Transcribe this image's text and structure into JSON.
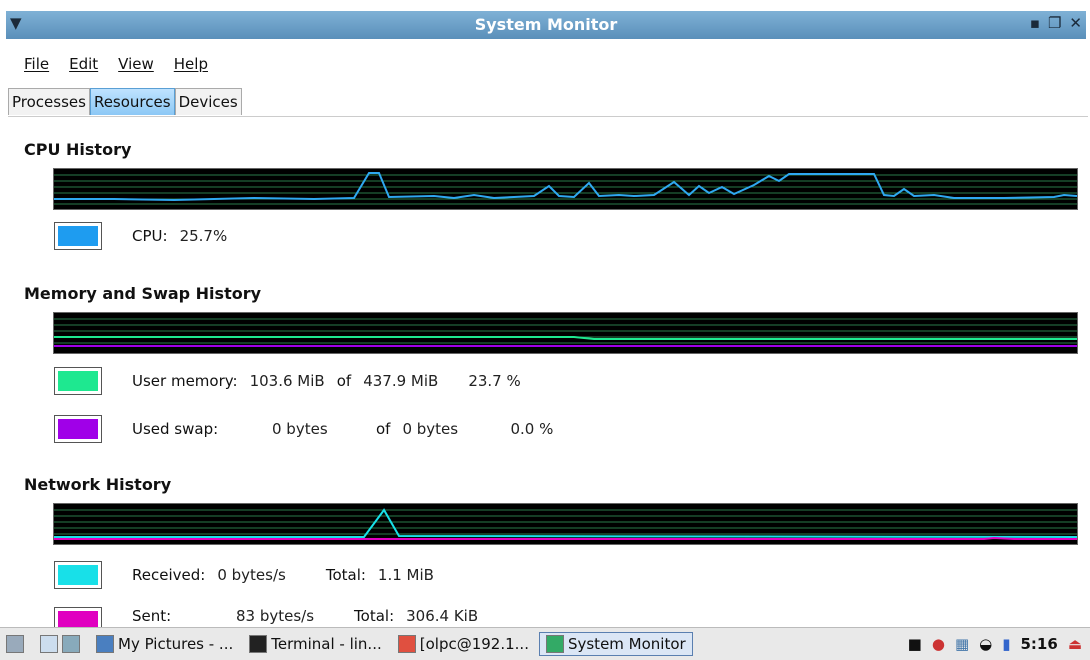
{
  "window": {
    "title": "System Monitor"
  },
  "menu": {
    "file": "File",
    "edit": "Edit",
    "view": "View",
    "help": "Help"
  },
  "tabs": [
    {
      "label": "Processes"
    },
    {
      "label": "Resources"
    },
    {
      "label": "Devices"
    }
  ],
  "cpu": {
    "title": "CPU History",
    "label": "CPU:",
    "value": "25.7%",
    "color": "#1e9cf0"
  },
  "memory": {
    "title": "Memory and Swap History",
    "user": {
      "label": "User memory:",
      "used": "103.6 MiB",
      "of": "of",
      "total": "437.9 MiB",
      "pct": "23.7 %",
      "color": "#1ee890"
    },
    "swap": {
      "label": "Used swap:",
      "used": "0 bytes",
      "of": "of",
      "total": "0 bytes",
      "pct": "0.0 %",
      "color": "#a000e8"
    }
  },
  "network": {
    "title": "Network History",
    "received": {
      "label": "Received:",
      "rate": "0 bytes/s",
      "total_label": "Total:",
      "total": "1.1 MiB",
      "color": "#18e0e8"
    },
    "sent": {
      "label": "Sent:",
      "rate": "83 bytes/s",
      "total_label": "Total:",
      "total": "306.4 KiB",
      "color": "#e000c0"
    }
  },
  "taskbar": {
    "items": [
      {
        "label": "My Pictures - ..."
      },
      {
        "label": "Terminal - lin..."
      },
      {
        "label": "[olpc@192.1..."
      },
      {
        "label": "System Monitor"
      }
    ],
    "clock": "5:16"
  }
}
